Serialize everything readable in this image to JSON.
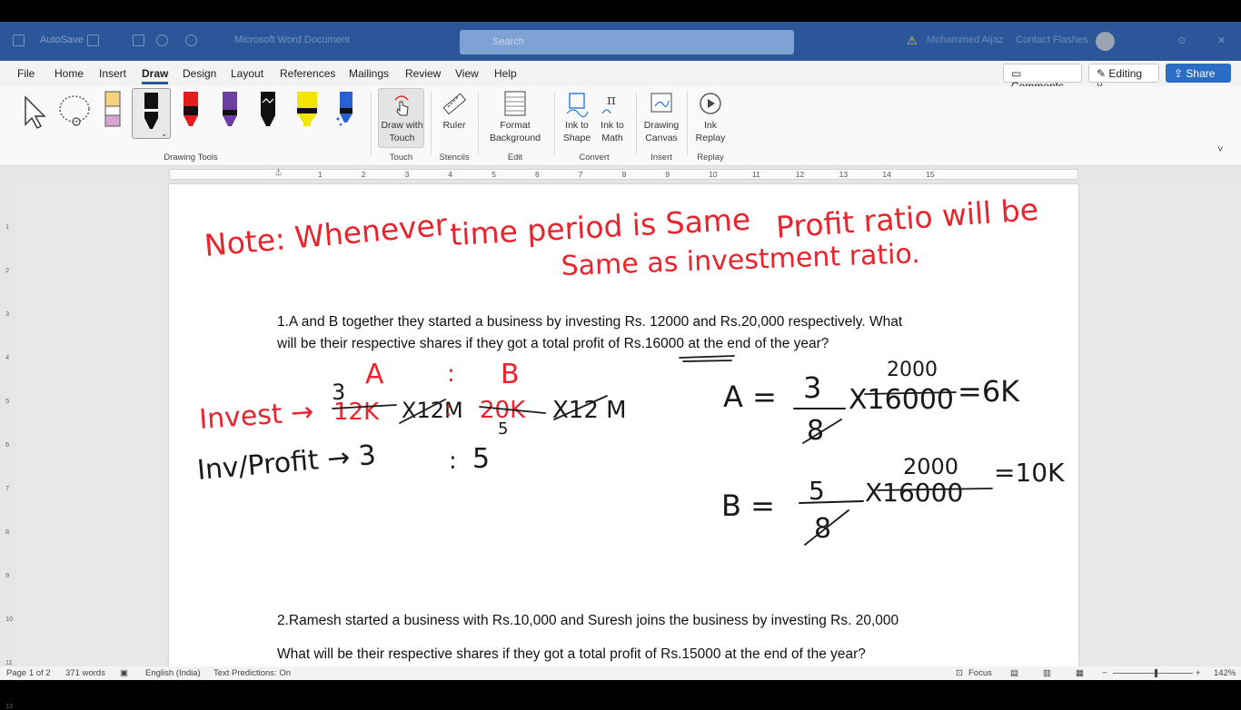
{
  "titlebar": {
    "app": "AutoSave",
    "doc_name": "Microsoft Word Document",
    "search_placeholder": "Search",
    "user": "Mohammed Aijaz",
    "status": "Contact Flashes"
  },
  "menu": {
    "items": [
      "File",
      "Home",
      "Insert",
      "Draw",
      "Design",
      "Layout",
      "References",
      "Mailings",
      "Review",
      "View",
      "Help"
    ],
    "active": "Draw"
  },
  "menu_actions": {
    "comments": "Comments",
    "editing": "Editing",
    "share": "Share"
  },
  "ribbon": {
    "tools": [
      {
        "name": "select",
        "color": "#333333"
      },
      {
        "name": "lasso",
        "color": "#333333"
      },
      {
        "name": "eraser",
        "color": "#d9a3d1"
      },
      {
        "name": "pen-black",
        "color": "#111111"
      },
      {
        "name": "pen-red",
        "color": "#e11d1d"
      },
      {
        "name": "pen-purple",
        "color": "#6a3fa0"
      },
      {
        "name": "pen-galaxy",
        "color": "#111111"
      },
      {
        "name": "highlighter-yellow",
        "color": "#f2e600"
      },
      {
        "name": "pen-blue",
        "color": "#2a5fd6"
      }
    ],
    "drawing_tools_label": "Drawing Tools",
    "draw_with_touch": [
      "Draw with",
      "Touch"
    ],
    "touch_label": "Touch",
    "ruler": "Ruler",
    "stencils_label": "Stencils",
    "format_background": [
      "Format",
      "Background"
    ],
    "edit_label": "Edit",
    "ink_to_shape": [
      "Ink to",
      "Shape"
    ],
    "ink_to_math": [
      "Ink to",
      "Math"
    ],
    "convert_label": "Convert",
    "drawing_canvas": [
      "Drawing",
      "Canvas"
    ],
    "insert_label": "Insert",
    "ink_replay": [
      "Ink",
      "Replay"
    ],
    "replay_label": "Replay"
  },
  "ruler": {
    "ticks": [
      "1",
      "2",
      "3",
      "4",
      "5",
      "6",
      "7",
      "8",
      "9",
      "10",
      "11",
      "12",
      "13",
      "14",
      "15"
    ],
    "vticks": [
      "1",
      "2",
      "3",
      "4",
      "5",
      "6",
      "7",
      "8",
      "9",
      "10",
      "11",
      "12"
    ]
  },
  "document": {
    "q1_line1": "1.A and B together they started a business by investing Rs. 12000 and Rs.20,000 respectively. What",
    "q1_line2": "will be their respective shares if they got a total profit of Rs.16000 at the end of the year?",
    "q2_line1": "2.Ramesh started a business with Rs.10,000 and Suresh joins the business by investing Rs. 20,000",
    "q2_line2": "What will be their respective shares if they got a total profit of Rs.15000 at the end of the year?"
  },
  "ink_colors": {
    "red": "#e8242c",
    "black": "#1a1a1a"
  },
  "statusbar": {
    "page": "Page 1 of 2",
    "words": "371 words",
    "language": "English (India)",
    "predictions": "Text Predictions: On",
    "focus": "Focus",
    "zoom": "142%"
  }
}
